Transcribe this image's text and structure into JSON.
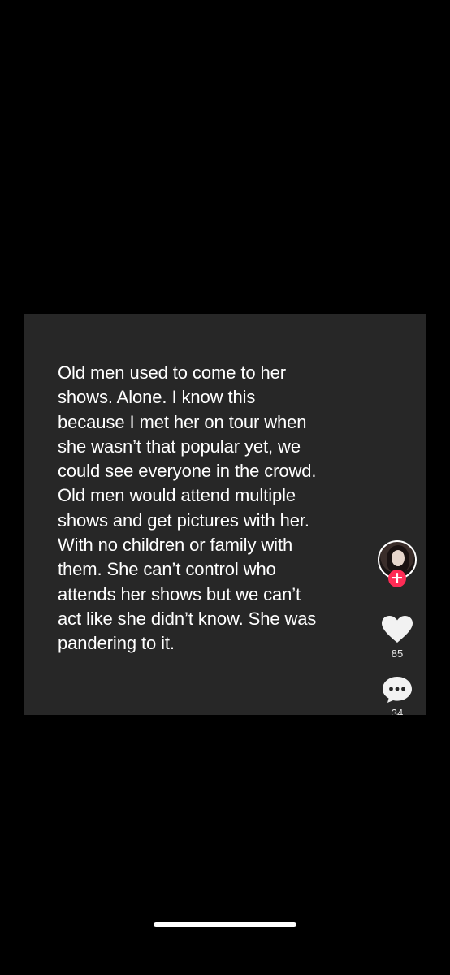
{
  "comment": {
    "text": "Old men used to come to her\nshows. Alone. I know this\nbecause I met her on tour when\nshe wasn’t that popular yet, we\ncould see everyone in the crowd.\nOld men would attend multiple\nshows and get pictures with her.\nWith no children or family with\nthem. She can’t control who\nattends her shows but we can’t\nact like she didn’t know. She was\npandering to it."
  },
  "sidebar": {
    "follow_symbol": "+",
    "like_count": "85",
    "comment_count": "34"
  },
  "colors": {
    "background": "#000000",
    "card": "#272727",
    "text": "#ffffff",
    "follow_accent": "#fe2c55"
  },
  "icons": {
    "avatar": "profile-avatar",
    "follow": "plus-icon",
    "like": "heart-icon",
    "comment": "comment-bubble-icon"
  }
}
